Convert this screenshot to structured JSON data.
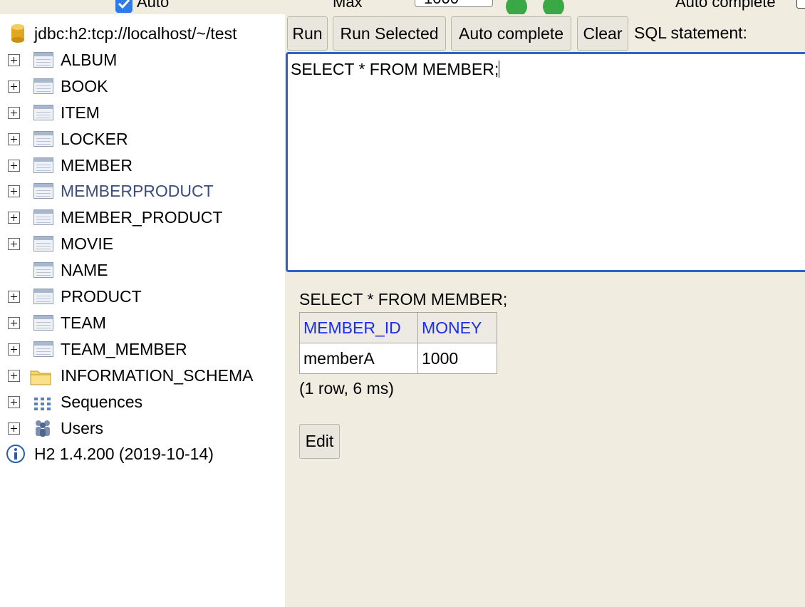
{
  "toolbar_top": {
    "auto_commit_checked": true,
    "auto_commit_label": "Auto",
    "max_label": "Max",
    "max_value": "1000",
    "auto_complete_label": "Auto complete"
  },
  "tree": {
    "connection": "jdbc:h2:tcp://localhost/~/test",
    "items": [
      {
        "label": "ALBUM",
        "type": "table",
        "expandable": true
      },
      {
        "label": "BOOK",
        "type": "table",
        "expandable": true
      },
      {
        "label": "ITEM",
        "type": "table",
        "expandable": true
      },
      {
        "label": "LOCKER",
        "type": "table",
        "expandable": true
      },
      {
        "label": "MEMBER",
        "type": "table",
        "expandable": true
      },
      {
        "label": "MEMBERPRODUCT",
        "type": "table",
        "expandable": true,
        "highlighted": true
      },
      {
        "label": "MEMBER_PRODUCT",
        "type": "table",
        "expandable": true
      },
      {
        "label": "MOVIE",
        "type": "table",
        "expandable": true
      },
      {
        "label": "NAME",
        "type": "table",
        "expandable": false
      },
      {
        "label": "PRODUCT",
        "type": "table",
        "expandable": true
      },
      {
        "label": "TEAM",
        "type": "table",
        "expandable": true
      },
      {
        "label": "TEAM_MEMBER",
        "type": "table",
        "expandable": true
      },
      {
        "label": "INFORMATION_SCHEMA",
        "type": "folder",
        "expandable": true
      },
      {
        "label": "Sequences",
        "type": "sequences",
        "expandable": true
      },
      {
        "label": "Users",
        "type": "users",
        "expandable": true
      }
    ],
    "version": "H2 1.4.200 (2019-10-14)"
  },
  "buttons": {
    "run": "Run",
    "run_selected": "Run Selected",
    "auto_complete": "Auto complete",
    "clear": "Clear",
    "sql_statement_label": "SQL statement:"
  },
  "editor": {
    "sql": "SELECT * FROM MEMBER;"
  },
  "result": {
    "query": "SELECT * FROM MEMBER;",
    "columns": [
      "MEMBER_ID",
      "MONEY"
    ],
    "rows": [
      [
        "memberA",
        "1000"
      ]
    ],
    "info": "(1 row, 6 ms)",
    "edit_label": "Edit"
  },
  "colors": {
    "panel_bg": "#f0ede0",
    "editor_border": "#2f62c4",
    "column_header_text": "#1a2ee8",
    "highlighted_node": "#3a4e78"
  }
}
